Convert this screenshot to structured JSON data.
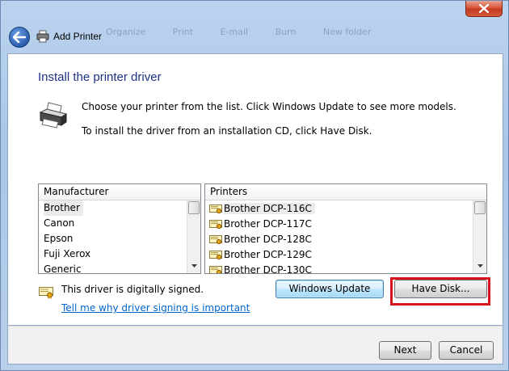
{
  "window": {
    "title": "Add Printer",
    "ghost_items": [
      "Organize",
      "Print",
      "E-mail",
      "Burn",
      "New folder"
    ]
  },
  "page": {
    "heading": "Install the printer driver",
    "instruction_1": "Choose your printer from the list. Click Windows Update to see more models.",
    "instruction_2": "To install the driver from an installation CD, click Have Disk."
  },
  "manufacturer_list": {
    "header": "Manufacturer",
    "items": [
      "Brother",
      "Canon",
      "Epson",
      "Fuji Xerox",
      "Generic"
    ],
    "selected_index": 0
  },
  "printer_list": {
    "header": "Printers",
    "items": [
      "Brother DCP-116C",
      "Brother DCP-117C",
      "Brother DCP-128C",
      "Brother DCP-129C",
      "Brother DCP-130C"
    ],
    "selected_index": 0
  },
  "signing": {
    "status_text": "This driver is digitally signed.",
    "link_text": "Tell me why driver signing is important"
  },
  "buttons": {
    "windows_update": "Windows Update",
    "have_disk": "Have Disk...",
    "next": "Next",
    "cancel": "Cancel"
  },
  "colors": {
    "heading": "#1e3287",
    "link": "#0066cc",
    "highlight": "#d4131d"
  }
}
